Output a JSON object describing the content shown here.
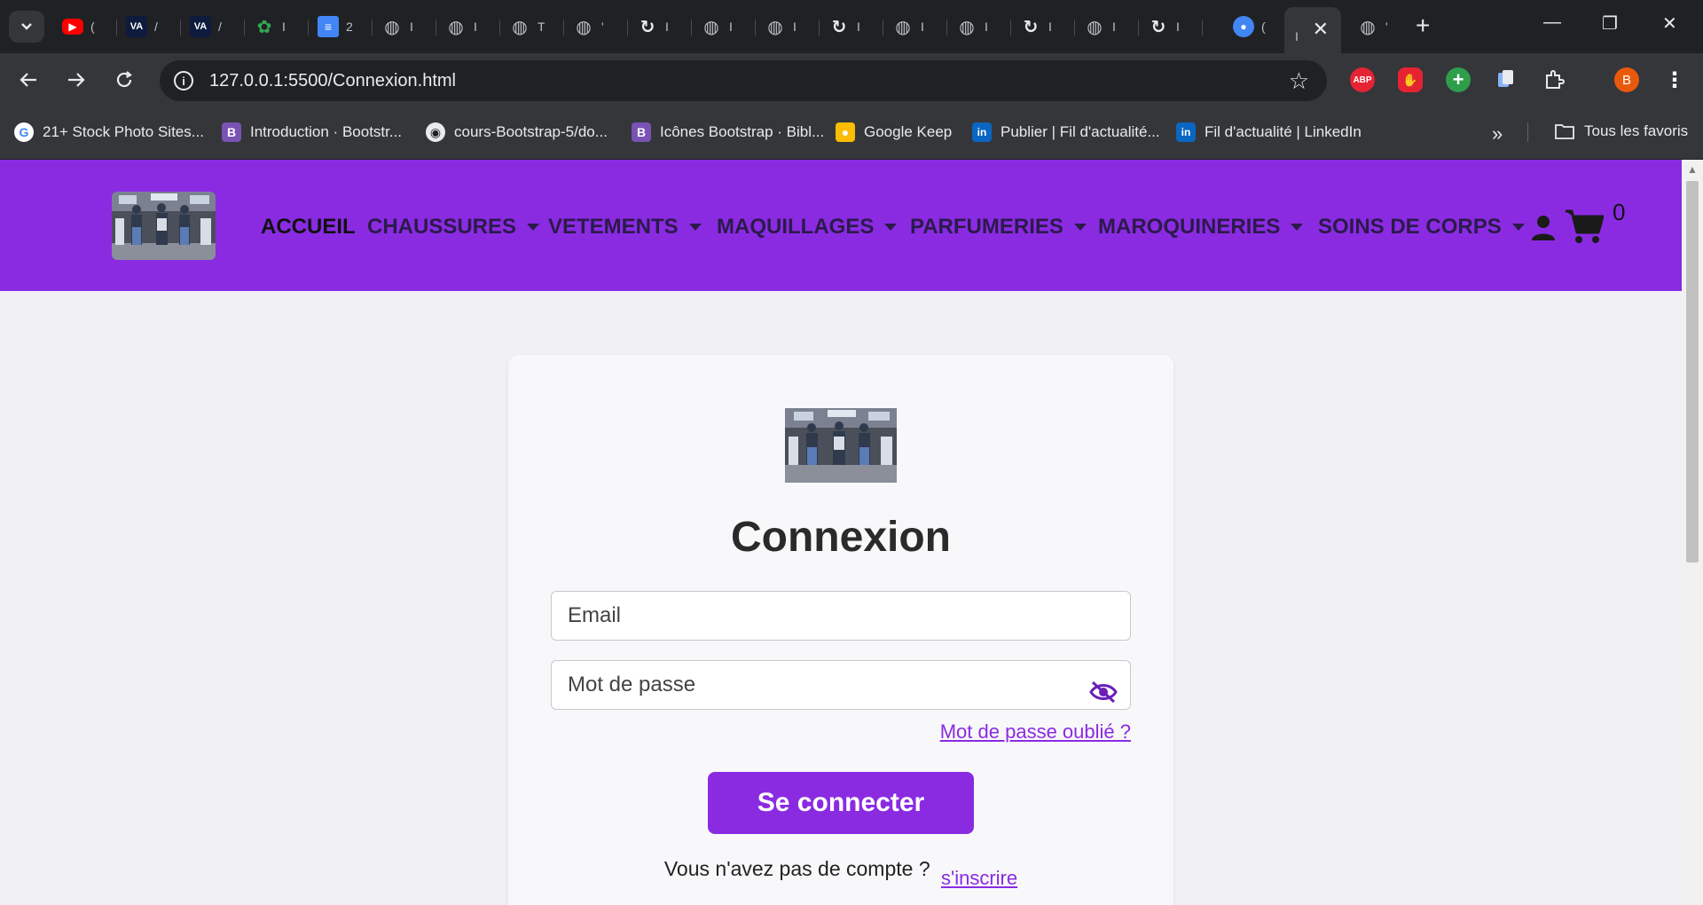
{
  "browser": {
    "tabs": [
      {
        "letter": "(",
        "icon": "youtube-icon",
        "color": "#ff0000"
      },
      {
        "letter": "/",
        "icon": "va-icon",
        "color": "#ffffff"
      },
      {
        "letter": "/",
        "icon": "va-icon",
        "color": "#ffffff"
      },
      {
        "letter": "I",
        "icon": "plant-icon",
        "color": "#34a853"
      },
      {
        "letter": "2",
        "icon": "docs-icon",
        "color": "#4285f4"
      },
      {
        "letter": "I",
        "icon": "globe-icon",
        "color": "#9aa0a6"
      },
      {
        "letter": "I",
        "icon": "globe-icon",
        "color": "#9aa0a6"
      },
      {
        "letter": "T",
        "icon": "globe-icon",
        "color": "#9aa0a6"
      },
      {
        "letter": "'",
        "icon": "globe-icon",
        "color": "#9aa0a6"
      },
      {
        "letter": "I",
        "icon": "sync-icon",
        "color": "#e8eaed"
      },
      {
        "letter": "I",
        "icon": "globe-icon",
        "color": "#9aa0a6"
      },
      {
        "letter": "I",
        "icon": "globe-icon",
        "color": "#9aa0a6"
      },
      {
        "letter": "I",
        "icon": "sync-icon",
        "color": "#e8eaed"
      },
      {
        "letter": "I",
        "icon": "globe-icon",
        "color": "#9aa0a6"
      },
      {
        "letter": "I",
        "icon": "globe-icon",
        "color": "#9aa0a6"
      },
      {
        "letter": "I",
        "icon": "sync-icon",
        "color": "#e8eaed"
      },
      {
        "letter": "I",
        "icon": "globe-icon",
        "color": "#9aa0a6"
      },
      {
        "letter": "I",
        "icon": "sync-icon",
        "color": "#e8eaed"
      },
      {
        "letter": "(",
        "icon": "notification-icon",
        "color": "#4285f4"
      }
    ],
    "active_tab_letter": "I",
    "last_tab_letter": "'",
    "url": "127.0.0.1:5500/Connexion.html",
    "profile_initial": "B",
    "extensions": {
      "abp": "ABP"
    },
    "bookmarks": [
      {
        "label": "21+ Stock Photo Sites...",
        "icon": "google-icon"
      },
      {
        "label": "Introduction · Bootstr...",
        "icon": "bootstrap-icon"
      },
      {
        "label": "cours-Bootstrap-5/do...",
        "icon": "github-icon"
      },
      {
        "label": "Icônes Bootstrap · Bibl...",
        "icon": "bootstrap-icon"
      },
      {
        "label": "Google Keep",
        "icon": "keep-icon"
      },
      {
        "label": "Publier | Fil d'actualité...",
        "icon": "linkedin-icon"
      },
      {
        "label": "Fil d'actualité | LinkedIn",
        "icon": "linkedin-icon"
      }
    ],
    "all_bookmarks": "Tous les favoris"
  },
  "nav": {
    "home": "ACCUEIL",
    "menus": [
      "CHAUSSURES",
      "VETEMENTS",
      "MAQUILLAGES",
      "PARFUMERIES",
      "MAROQUINERIES",
      "SOINS DE CORPS"
    ],
    "cart_count": "0",
    "brand_color": "#8a2be2"
  },
  "form": {
    "title": "Connexion",
    "email_placeholder": "Email",
    "password_placeholder": "Mot de passe",
    "forgot": "Mot de passe oublié ?",
    "submit": "Se connecter",
    "no_account": "Vous n'avez pas de compte ?",
    "signup": "s'inscrire"
  }
}
